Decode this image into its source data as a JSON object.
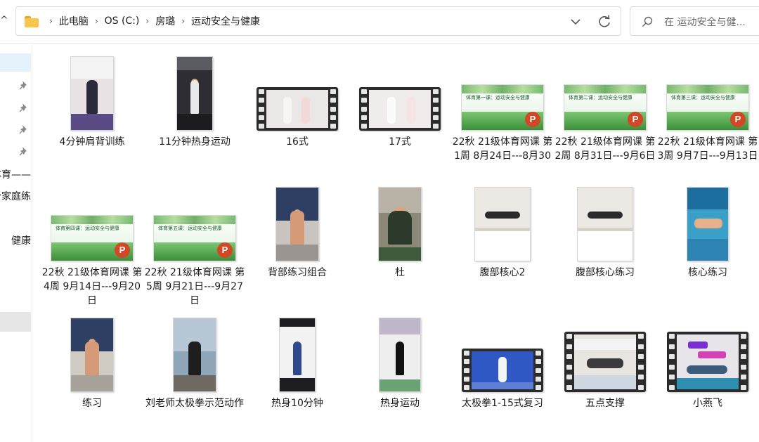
{
  "address_bar": {
    "breadcrumbs": [
      "此电脑",
      "OS (C:)",
      "房璐",
      "运动安全与健康"
    ]
  },
  "search": {
    "placeholder": "在 运动安全与健..."
  },
  "nav": {
    "labels": [
      "体育——",
      "分家庭练",
      "健康"
    ]
  },
  "files": [
    {
      "name": "4分钟肩背训练",
      "kind": "image"
    },
    {
      "name": "11分钟热身运动",
      "kind": "image"
    },
    {
      "name": "16式",
      "kind": "video"
    },
    {
      "name": "17式",
      "kind": "video"
    },
    {
      "name": "22秋 21级体育网课   第1周 8月24日---8月30",
      "kind": "pptx",
      "slide_title": "体育第一课：运动安全与健康（一）"
    },
    {
      "name": "22秋 21级体育网课   第2周 8月31日---9月6日",
      "kind": "pptx",
      "slide_title": "体育第二课：运动安全与健康（二）"
    },
    {
      "name": "22秋 21级体育网课   第3周 9月7日---9月13日",
      "kind": "pptx",
      "slide_title": "体育第三课：运动安全与健康"
    },
    {
      "name": "22秋 21级体育网课   第4周 9月14日---9月20日",
      "kind": "pptx",
      "slide_title": "体育第四课：运动安全与健康"
    },
    {
      "name": "22秋 21级体育网课   第5周 9月21日---9月27日",
      "kind": "pptx",
      "slide_title": "体育第五课：运动安全与健康"
    },
    {
      "name": "背部练习组合",
      "kind": "image"
    },
    {
      "name": "杜",
      "kind": "image"
    },
    {
      "name": "腹部核心2",
      "kind": "image"
    },
    {
      "name": "腹部核心练习",
      "kind": "image"
    },
    {
      "name": "核心练习",
      "kind": "image"
    },
    {
      "name": "练习",
      "kind": "image"
    },
    {
      "name": "刘老师太极拳示范动作",
      "kind": "image"
    },
    {
      "name": "热身10分钟",
      "kind": "image"
    },
    {
      "name": "热身运动",
      "kind": "image"
    },
    {
      "name": "太极拳1-15式复习",
      "kind": "video"
    },
    {
      "name": "五点支撑",
      "kind": "video"
    },
    {
      "name": "小燕飞",
      "kind": "video"
    }
  ],
  "colors": {
    "accent_selection": "#e5f1fb",
    "ppt_badge": "#d24726",
    "folder": "#f7c64a"
  }
}
